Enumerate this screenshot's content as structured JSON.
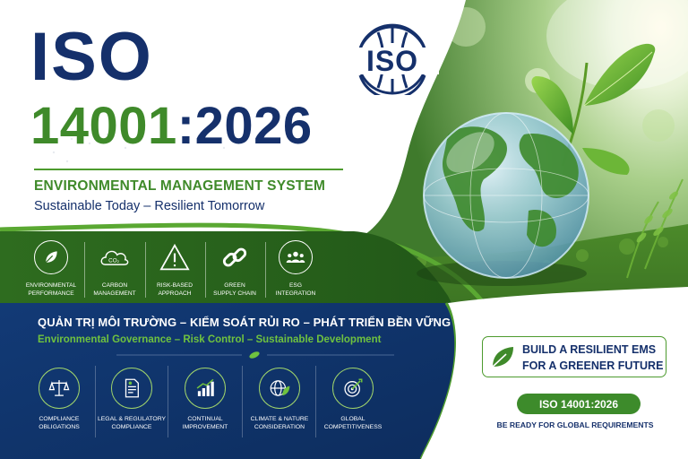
{
  "header": {
    "title_iso": "ISO",
    "title_number_green": "14001",
    "title_number_blue": ":2026",
    "subtitle": "ENVIRONMENTAL MANAGEMENT SYSTEM",
    "tagline": "Sustainable Today – Resilient Tomorrow"
  },
  "logo": {
    "text": "ISO",
    "icon": "iso-globe-logo"
  },
  "colors": {
    "navy": "#15306b",
    "green": "#3f8a2a",
    "light_green": "#6fc23f",
    "band_green": "#2d6a1e",
    "band_blue": "#143a74"
  },
  "features_top": [
    {
      "label_line1": "Environmental",
      "label_line2": "Performance",
      "icon": "leaf-icon"
    },
    {
      "label_line1": "Carbon",
      "label_line2": "Management",
      "icon": "co2-cloud-icon"
    },
    {
      "label_line1": "Risk-Based",
      "label_line2": "Approach",
      "icon": "warning-icon"
    },
    {
      "label_line1": "Green",
      "label_line2": "Supply Chain",
      "icon": "chain-link-icon"
    },
    {
      "label_line1": "ESG",
      "label_line2": "Integration",
      "icon": "people-group-icon"
    }
  ],
  "blue_band": {
    "headline_vn": "QUẢN TRỊ MÔI TRƯỜNG – KIỂM SOÁT RỦI RO – PHÁT TRIỂN BỀN VỮNG",
    "headline_en": "Environmental Governance – Risk Control – Sustainable Development"
  },
  "features_bottom": [
    {
      "label_line1": "Compliance",
      "label_line2": "Obligations",
      "icon": "balance-scale-icon"
    },
    {
      "label_line1": "Legal & Regulatory",
      "label_line2": "Compliance",
      "icon": "document-check-icon"
    },
    {
      "label_line1": "Continual",
      "label_line2": "Improvement",
      "icon": "bar-growth-icon"
    },
    {
      "label_line1": "Climate & Nature",
      "label_line2": "Consideration",
      "icon": "globe-leaf-icon"
    },
    {
      "label_line1": "Global",
      "label_line2": "Competitiveness",
      "icon": "target-icon"
    }
  ],
  "cta": {
    "line1": "BUILD A RESILIENT EMS",
    "line2": "FOR A GREENER FUTURE",
    "icon": "leaf-icon",
    "badge": "ISO 14001:2026",
    "footer": "BE READY FOR GLOBAL REQUIREMENTS"
  }
}
